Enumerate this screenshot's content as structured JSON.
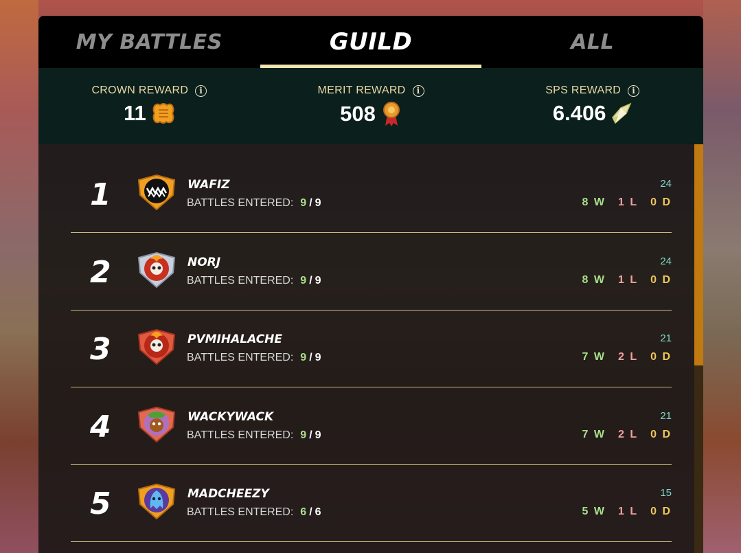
{
  "tabs": [
    {
      "label": "MY BATTLES",
      "active": false
    },
    {
      "label": "GUILD",
      "active": true
    },
    {
      "label": "ALL",
      "active": false
    }
  ],
  "rewards": [
    {
      "title": "CROWN REWARD",
      "value": "11",
      "icon": "crown-token-icon"
    },
    {
      "title": "MERIT REWARD",
      "value": "508",
      "icon": "merit-medal-icon"
    },
    {
      "title": "SPS REWARD",
      "value": "6.406",
      "icon": "sps-shard-icon"
    }
  ],
  "rows": [
    {
      "rank": "1",
      "name": "WAFIZ",
      "battles_label": "BATTLES ENTERED:",
      "entered": "9",
      "total": "9",
      "score": "24",
      "wins": "8 W",
      "losses": "1 L",
      "draws": "0 D",
      "avatar": "monster-mouth-avatar"
    },
    {
      "rank": "2",
      "name": "NORJ",
      "battles_label": "BATTLES ENTERED:",
      "entered": "9",
      "total": "9",
      "score": "24",
      "wins": "8 W",
      "losses": "1 L",
      "draws": "0 D",
      "avatar": "fire-skull-avatar-silver"
    },
    {
      "rank": "3",
      "name": "PVMIHALACHE",
      "battles_label": "BATTLES ENTERED:",
      "entered": "9",
      "total": "9",
      "score": "21",
      "wins": "7 W",
      "losses": "2 L",
      "draws": "0 D",
      "avatar": "fire-skull-avatar-red"
    },
    {
      "rank": "4",
      "name": "WACKYWACK",
      "battles_label": "BATTLES ENTERED:",
      "entered": "9",
      "total": "9",
      "score": "21",
      "wins": "7 W",
      "losses": "2 L",
      "draws": "0 D",
      "avatar": "goblin-avatar"
    },
    {
      "rank": "5",
      "name": "MADCHEEZY",
      "battles_label": "BATTLES ENTERED:",
      "entered": "6",
      "total": "6",
      "score": "15",
      "wins": "5 W",
      "losses": "1 L",
      "draws": "0 D",
      "avatar": "blue-ghost-avatar"
    }
  ]
}
